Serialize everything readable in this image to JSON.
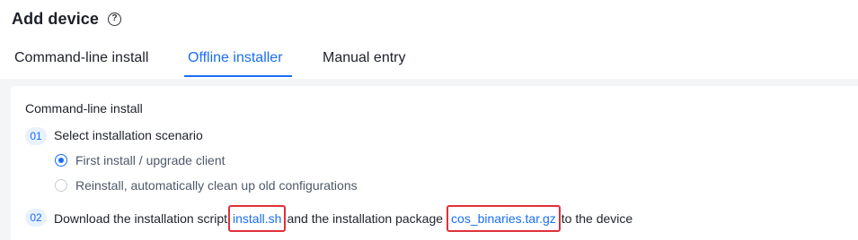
{
  "header": {
    "title": "Add device",
    "help_icon": "question-circle-icon"
  },
  "tabs": [
    {
      "label": "Command-line install",
      "active": false
    },
    {
      "label": "Offline installer",
      "active": true
    },
    {
      "label": "Manual entry",
      "active": false
    }
  ],
  "colors": {
    "accent": "#1a6ef5",
    "highlight_border": "#e0303a",
    "panel_bg": "#f4f5f7"
  },
  "section": {
    "title": "Command-line install",
    "steps": [
      {
        "number": "01",
        "text": "Select installation scenario",
        "options": [
          {
            "label": "First install / upgrade client",
            "checked": true
          },
          {
            "label": "Reinstall, automatically clean up old configurations",
            "checked": false
          }
        ]
      },
      {
        "number": "02",
        "prefix": "Download the installation script",
        "link1": "install.sh",
        "middle": "and the installation package",
        "link2": "cos_binaries.tar.gz",
        "suffix": "to the device"
      }
    ]
  }
}
